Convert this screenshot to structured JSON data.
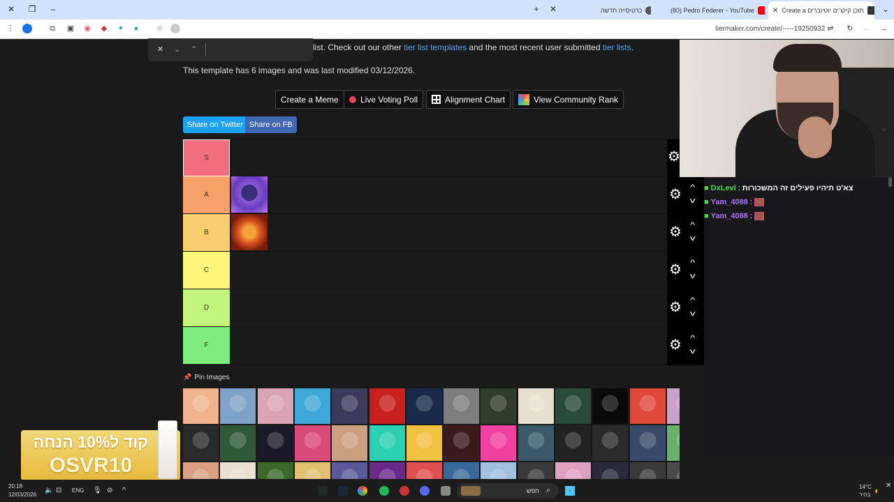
{
  "browser": {
    "tabs": [
      {
        "label": "Create a תוכן קיקרים יוטיוברים",
        "active": true
      },
      {
        "label": "(80) Pedro Federer - YouTube",
        "active": false
      },
      {
        "label": "כרטיסייה חדשה",
        "active": false
      }
    ],
    "url": "tiermaker.com/create/-----19250932"
  },
  "page": {
    "intro_pre": "list. Check out our other ",
    "intro_link1": "tier list templates",
    "intro_mid": " and the most recent user submitted ",
    "intro_link2": "tier lists",
    "intro_end": ".",
    "template_info": "This template has 6 images and was last modified 03/12/2026.",
    "buttons": {
      "meme": "Create a Meme",
      "poll": "Live Voting Poll",
      "align": "Alignment Chart",
      "rank": "View Community Rank"
    },
    "share": {
      "twitter": "Share on Twitter",
      "fb": "Share on FB"
    },
    "tiers": [
      {
        "label": "S",
        "color": "#f26d7d"
      },
      {
        "label": "A",
        "color": "#f7a06a"
      },
      {
        "label": "B",
        "color": "#f7cf70"
      },
      {
        "label": "C",
        "color": "#fbf67a"
      },
      {
        "label": "D",
        "color": "#c3f57c"
      },
      {
        "label": "F",
        "color": "#7dee7c"
      }
    ],
    "pin_label": "Pin Images"
  },
  "chat": {
    "messages": [
      {
        "user": "DxLevi",
        "text": "צא'ט תיהיו פעילים זה המשכורות",
        "color": "#44dd44"
      },
      {
        "user": "Yam_4088",
        "text": "",
        "color": "#a970ff"
      },
      {
        "user": "Yam_4088",
        "text": "",
        "color": "#a970ff"
      }
    ]
  },
  "promo": {
    "line1": "קוד ל10% הנחה",
    "line2": "OSVR10"
  },
  "taskbar": {
    "time": "20:18",
    "date": "12/03/2026",
    "lang": "ENG",
    "search": "חפש",
    "weather": "14°C",
    "weather_sub": "בהיר"
  }
}
